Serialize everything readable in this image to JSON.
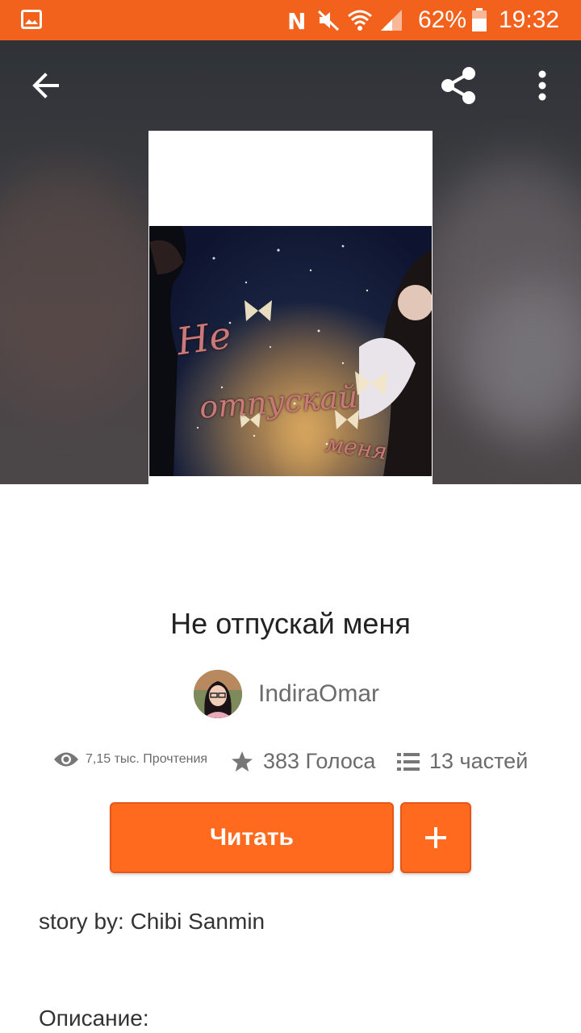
{
  "status_bar": {
    "battery": "62%",
    "time": "19:32"
  },
  "story": {
    "title": "Не отпускай меня",
    "author": "IndiraOmar",
    "reads": "7,15 тыс. Прочтения",
    "votes": "383 Голоса",
    "parts": "13 частей"
  },
  "cover": {
    "text_lines": [
      "Не",
      "отпускай",
      "меня"
    ]
  },
  "actions": {
    "read_label": "Читать",
    "add_label": "+"
  },
  "description": {
    "byline": "story by: Chibi Sanmin",
    "heading": "Описание:"
  },
  "colors": {
    "accent": "#ff6a1f",
    "status_bar": "#f2621c"
  },
  "icons": [
    "image-icon",
    "nfc-icon",
    "mute-icon",
    "wifi-icon",
    "signal-icon",
    "battery-icon",
    "back-arrow-icon",
    "share-icon",
    "more-vert-icon",
    "eye-icon",
    "star-icon",
    "list-icon",
    "plus-icon"
  ]
}
